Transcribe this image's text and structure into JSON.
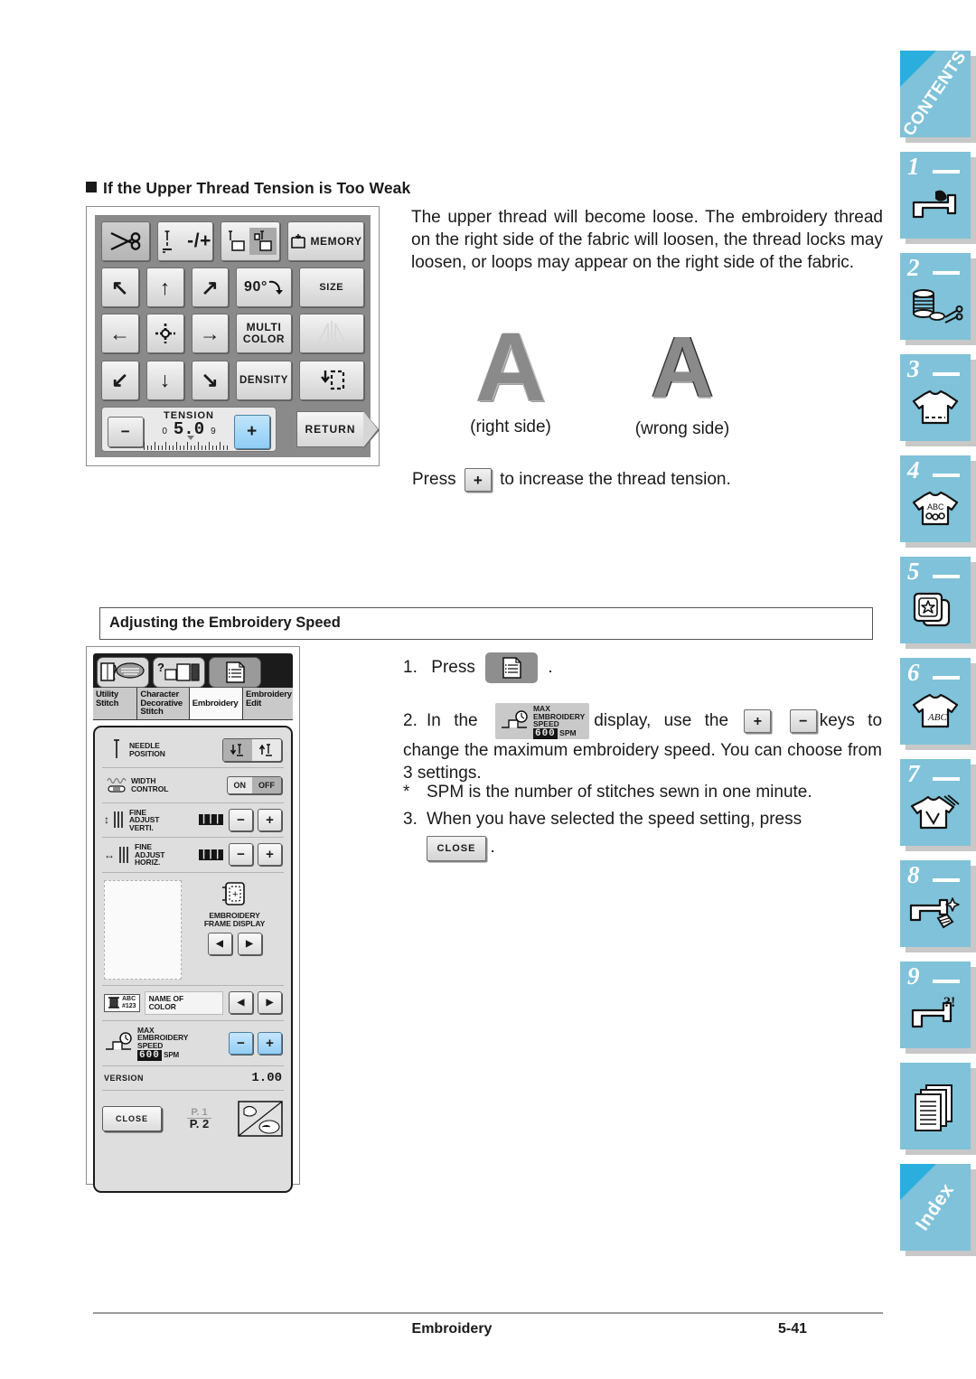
{
  "section1": {
    "heading": "If the Upper Thread Tension is Too Weak",
    "paragraph": "The upper thread will become loose. The embroidery thread on the right side of the fabric will loosen, the thread locks may loosen, or loops may appear on the right side of the fabric.",
    "sample_right_label": "(right side)",
    "sample_wrong_label": "(wrong side)",
    "sample_letter": "A",
    "press_prefix": "Press",
    "press_key": "+",
    "press_suffix": "to increase the thread tension."
  },
  "embroidery_screen": {
    "keys_row1": [
      {
        "name": "thread-cutter",
        "label": ""
      },
      {
        "name": "needle-position-minus-plus",
        "label": "-/+"
      },
      {
        "name": "single-multi-stitch",
        "label": ""
      },
      {
        "name": "memory",
        "label": "MEMORY"
      }
    ],
    "keys_row2": [
      {
        "name": "move-up-left",
        "label": ""
      },
      {
        "name": "move-up",
        "label": ""
      },
      {
        "name": "move-up-right",
        "label": ""
      },
      {
        "name": "rotate",
        "label": "90°"
      },
      {
        "name": "size",
        "label": "SIZE"
      }
    ],
    "keys_row3": [
      {
        "name": "move-left",
        "label": ""
      },
      {
        "name": "move-center",
        "label": ""
      },
      {
        "name": "move-right",
        "label": ""
      },
      {
        "name": "multi-color",
        "label": "MULTI COLOR"
      },
      {
        "name": "mirror-image",
        "label": ""
      }
    ],
    "keys_row4": [
      {
        "name": "move-down-left",
        "label": ""
      },
      {
        "name": "move-down",
        "label": ""
      },
      {
        "name": "move-down-right",
        "label": ""
      },
      {
        "name": "density",
        "label": "DENSITY"
      },
      {
        "name": "trial",
        "label": ""
      }
    ],
    "multi_color_line1": "MULTI",
    "multi_color_line2": "COLOR",
    "density_label": "DENSITY",
    "size_label": "SIZE",
    "memory_label": "MEMORY",
    "rotate_label": "90°",
    "tension": {
      "title": "TENSION",
      "value": "5.0",
      "min": "0",
      "max": "9",
      "minus": "−",
      "plus": "+"
    },
    "return_label": "RETURN"
  },
  "section2": {
    "heading": "Adjusting the Embroidery Speed",
    "steps": [
      {
        "num": "1.",
        "text_before": "Press",
        "text_after": "."
      },
      {
        "num": "2.",
        "text_before": "In the",
        "text_mid": "display, use the",
        "text_after": "keys to change the maximum embroidery speed. You can choose from 3 settings."
      },
      {
        "num": "*",
        "text": "SPM is the number of stitches sewn in one minute."
      },
      {
        "num": "3.",
        "text_before": "When you have selected the speed setting, press",
        "text_after": "."
      }
    ],
    "key_plus": "+",
    "key_minus": "−",
    "close_label": "CLOSE",
    "speed_badge": {
      "line1": "MAX",
      "line2": "EMBROIDERY",
      "line3": "SPEED",
      "value": "600",
      "unit": "SPM"
    }
  },
  "settings_screen": {
    "tabs": [
      {
        "label_line1": "Utility",
        "label_line2": "Stitch",
        "label_line3": "",
        "active": false
      },
      {
        "label_line1": "Character",
        "label_line2": "Decorative",
        "label_line3": "Stitch",
        "active": false
      },
      {
        "label_line1": "Embroidery",
        "label_line2": "",
        "label_line3": "",
        "active": true
      },
      {
        "label_line1": "Embroidery",
        "label_line2": "Edit",
        "label_line3": "",
        "active": false
      }
    ],
    "rows": [
      {
        "name": "needle-position",
        "label_line1": "NEEDLE",
        "label_line2": "POSITION"
      },
      {
        "name": "width-control",
        "label_line1": "WIDTH",
        "label_line2": "CONTROL",
        "on": "ON",
        "off": "OFF"
      },
      {
        "name": "fine-adjust-vertical",
        "label_line1": "FINE",
        "label_line2": "ADJUST",
        "label_line3": "VERTI."
      },
      {
        "name": "fine-adjust-horizontal",
        "label_line1": "FINE",
        "label_line2": "ADJUST",
        "label_line3": "HORIZ."
      }
    ],
    "frame_display_line1": "EMBROIDERY",
    "frame_display_line2": "FRAME DISPLAY",
    "name_of_color_line1": "NAME OF",
    "name_of_color_line2": "COLOR",
    "name_of_color_icon_line1": "ABC",
    "name_of_color_icon_line2": "#123",
    "max_speed_line1": "MAX",
    "max_speed_line2": "EMBROIDERY",
    "max_speed_line3": "SPEED",
    "max_speed_value": "600",
    "max_speed_unit": "SPM",
    "version_label": "VERSION",
    "version_value": "1.00",
    "close_label": "CLOSE",
    "page_current": "P. 1",
    "page_total": "P. 2",
    "minus": "−",
    "plus": "+",
    "prev": "◀",
    "next": "▶"
  },
  "sidebar": {
    "contents_label": "CONTENTS",
    "index_label": "Index",
    "tabs": [
      {
        "num": "1",
        "icon": "sewing-machine-icon"
      },
      {
        "num": "2",
        "icon": "thread-spool-scissors-icon"
      },
      {
        "num": "3",
        "icon": "tshirt-stitch-icon"
      },
      {
        "num": "4",
        "icon": "tshirt-abc-icon"
      },
      {
        "num": "5",
        "icon": "embroidery-frame-star-icon"
      },
      {
        "num": "6",
        "icon": "tshirt-lettering-icon"
      },
      {
        "num": "7",
        "icon": "tshirt-applique-icon"
      },
      {
        "num": "8",
        "icon": "machine-maintenance-icon"
      },
      {
        "num": "9",
        "icon": "machine-troubleshoot-icon"
      },
      {
        "num": "",
        "icon": "appendix-pages-icon"
      }
    ]
  },
  "footer": {
    "title": "Embroidery",
    "page": "5-41"
  },
  "colors": {
    "tab_blue": "#7fc2d9",
    "tab_corner_blue": "#2aaede",
    "key_highlight_blue": "#9fd4f7",
    "lcd_bezel": "#8a8a8a"
  }
}
